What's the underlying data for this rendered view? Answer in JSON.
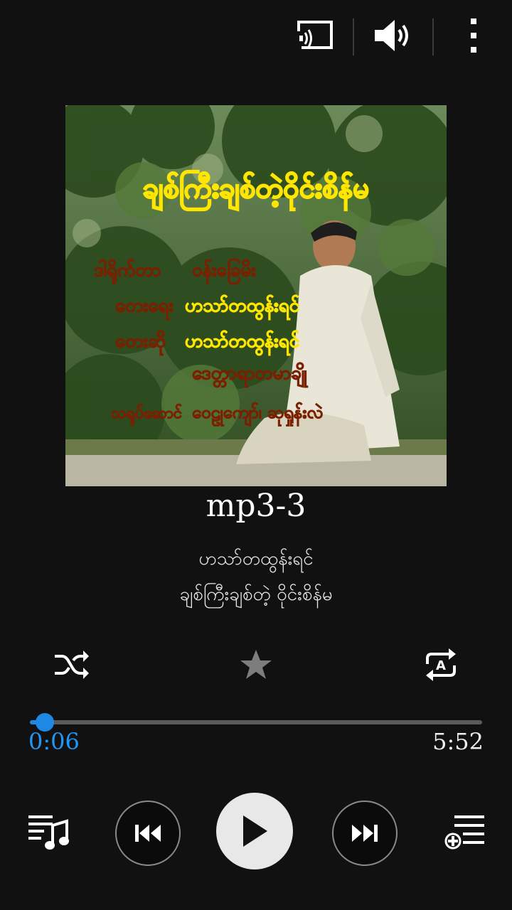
{
  "header": {
    "icons": [
      "cast-icon",
      "volume-icon",
      "more-vert-icon"
    ]
  },
  "album_art": {
    "title_text": "ချစ်ကြီးချစ်တဲ့ဝိုင်းစိန်မ",
    "credits": [
      {
        "label": "ဒါရိုက်တာ",
        "value": "ဝန်းခြေမိး"
      },
      {
        "label": "တေးရေး",
        "value": "ဟသာ်တထွန်းရင်"
      },
      {
        "label": "တေးဆို",
        "value": "ဟသာ်တထွန်းရင်"
      },
      {
        "label": "",
        "value": "ဒေတ္တာရာတမာချို"
      },
      {
        "label": "သရုပ်ဆောင်",
        "value": "ဝေဠုကျော်၊ ဆုရှုန်းလဲ"
      }
    ]
  },
  "track": {
    "title": "mp3-3",
    "artist": "ဟသာ်တထွန်းရင်",
    "album": "ချစ်ကြီးချစ်တဲ့ ဝိုင်းစိန်မ"
  },
  "modes": {
    "shuffle_icon": "shuffle-icon",
    "favorite_icon": "star-icon",
    "repeat_icon": "repeat-a-icon"
  },
  "progress": {
    "current": "0:06",
    "total": "5:52",
    "fraction": 0.017,
    "color": "#1e88e5"
  },
  "controls": {
    "icons": [
      "playlist-music-icon",
      "skip-previous-icon",
      "play-icon",
      "skip-next-icon",
      "playlist-add-icon"
    ]
  }
}
